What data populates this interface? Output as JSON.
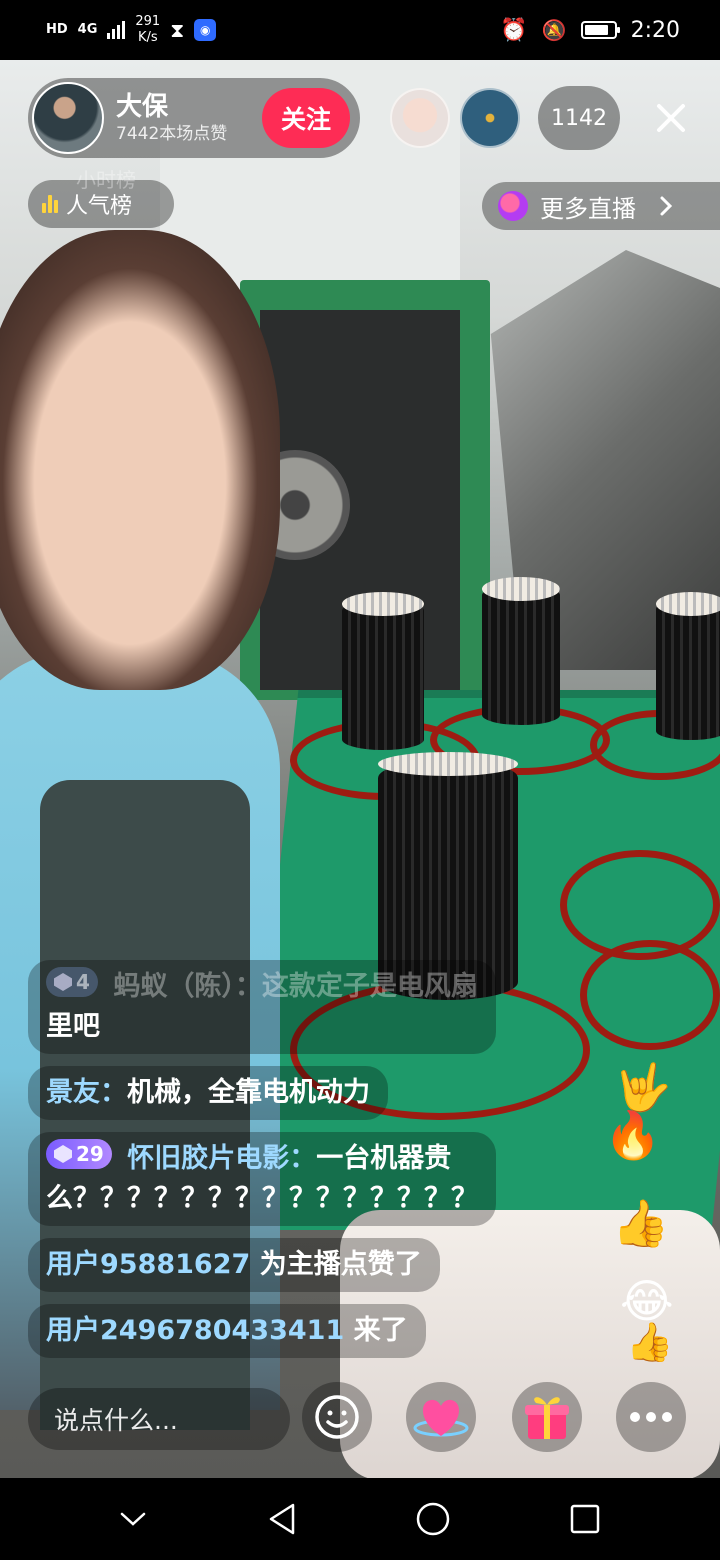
{
  "status_bar": {
    "network_type": "HD",
    "signal_label": "4G",
    "speed_value": "291",
    "speed_unit": "K/s",
    "time": "2:20",
    "battery_level": 0.85
  },
  "host": {
    "name": "大保",
    "likes": "7442本场点赞",
    "follow_label": "关注"
  },
  "viewer_count": "1142",
  "rank_label": "人气榜",
  "rank_faded_label": "小时榜",
  "more_live_label": "更多直播",
  "comments": [
    {
      "badge": "4",
      "name": "蚂蚁（陈）：",
      "text_line1": "这款定子是电风扇",
      "text_line2": "里吧"
    },
    {
      "name": "景友：",
      "text": "机械，全靠电机动力"
    },
    {
      "badge": "29",
      "name": "怀旧胶片电影：",
      "text_line1": "一台机器贵",
      "text_line2": "么？？？？？？？？？？？？？？？"
    },
    {
      "name": "用户95881627",
      "text": "为主播点赞了"
    },
    {
      "name": "用户2496780433411",
      "text": "来了"
    }
  ],
  "input_placeholder": "说点什么...",
  "icons": {
    "close": "close-icon",
    "rank": "bar-chart-icon",
    "more_live": "planet-icon",
    "emoji": "emoji-icon",
    "heart": "heart-icon",
    "gift": "gift-icon",
    "more": "more-dots-icon",
    "nav_back": "triangle-back-icon",
    "nav_home": "circle-home-icon",
    "nav_recent": "square-recent-icon",
    "nav_collapse": "chevron-down-icon"
  },
  "colors": {
    "follow": "#fe2c55",
    "comment_name": "#9ed9ff",
    "badge_purple": "#7a5cff"
  }
}
